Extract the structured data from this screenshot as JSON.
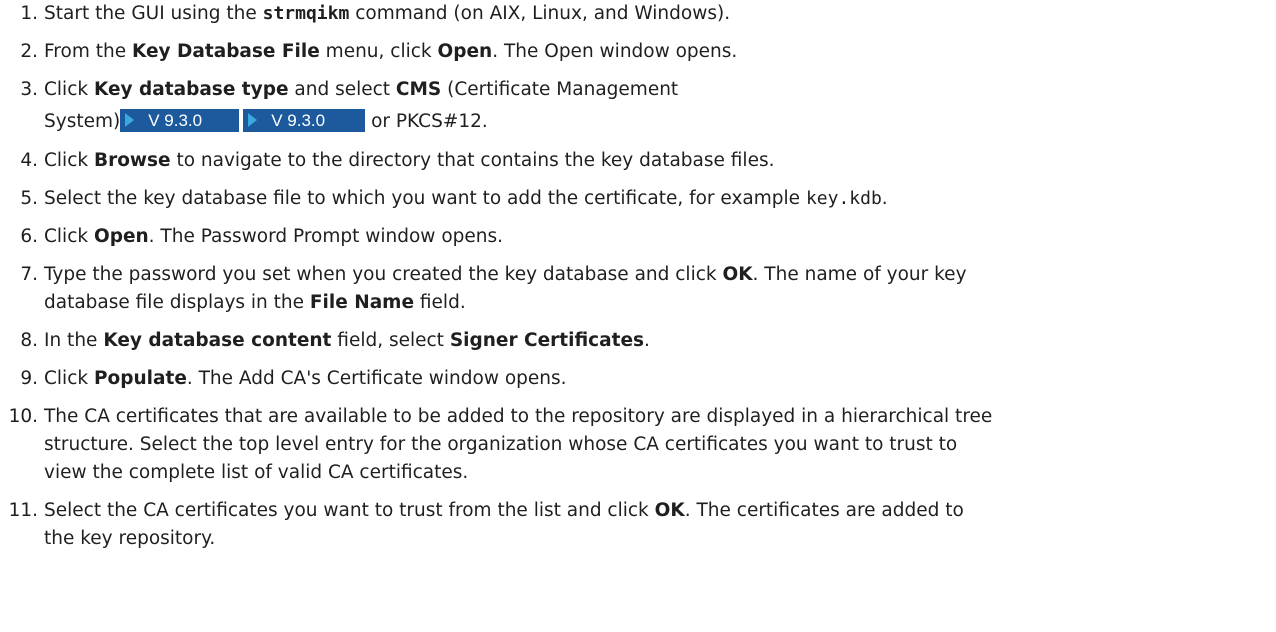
{
  "steps": [
    {
      "num": "1.",
      "t1": "Start the GUI using the ",
      "cmd": "strmqikm",
      "t2": " command (on AIX, Linux, and Windows)."
    },
    {
      "num": "2.",
      "t1": "From the ",
      "b1": "Key Database File",
      "t2": " menu, click ",
      "b2": "Open",
      "t3": ". The Open window opens."
    },
    {
      "num": "3.",
      "t1": "Click ",
      "b1": "Key database type",
      "t2": " and select ",
      "b2": "CMS",
      "t3": " (Certificate Management",
      "t4": "System)",
      "badge1": "V 9.3.0",
      "badge2": "V 9.3.0",
      "t5": " or PKCS#12."
    },
    {
      "num": "4.",
      "t1": "Click ",
      "b1": "Browse",
      "t2": " to navigate to the directory that contains the key database files."
    },
    {
      "num": "5.",
      "t1": "Select the key database file to which you want to add the certificate, for example ",
      "code": "key.kdb",
      "t2": "."
    },
    {
      "num": "6.",
      "t1": "Click ",
      "b1": "Open",
      "t2": ". The Password Prompt window opens."
    },
    {
      "num": "7.",
      "t1": "Type the password you set when you created the key database and click ",
      "b1": "OK",
      "t2": ". The name of your key",
      "t3": "database file displays in the ",
      "b2": "File Name",
      "t4": " field."
    },
    {
      "num": "8.",
      "t1": "In the ",
      "b1": "Key database content",
      "t2": " field, select ",
      "b2": "Signer Certificates",
      "t3": "."
    },
    {
      "num": "9.",
      "t1": "Click ",
      "b1": "Populate",
      "t2": ". The Add CA's Certificate window opens."
    },
    {
      "num": "10.",
      "l1": "The CA certificates that are available to be added to the repository are displayed in a hierarchical tree",
      "l2": "structure. Select the top level entry for the organization whose CA certificates you want to trust to",
      "l3": "view the complete list of valid CA certificates."
    },
    {
      "num": "11.",
      "t1": "Select the CA certificates you want to trust from the list and click ",
      "b1": "OK",
      "t2": ". The certificates are added to",
      "t3": "the key repository."
    }
  ]
}
